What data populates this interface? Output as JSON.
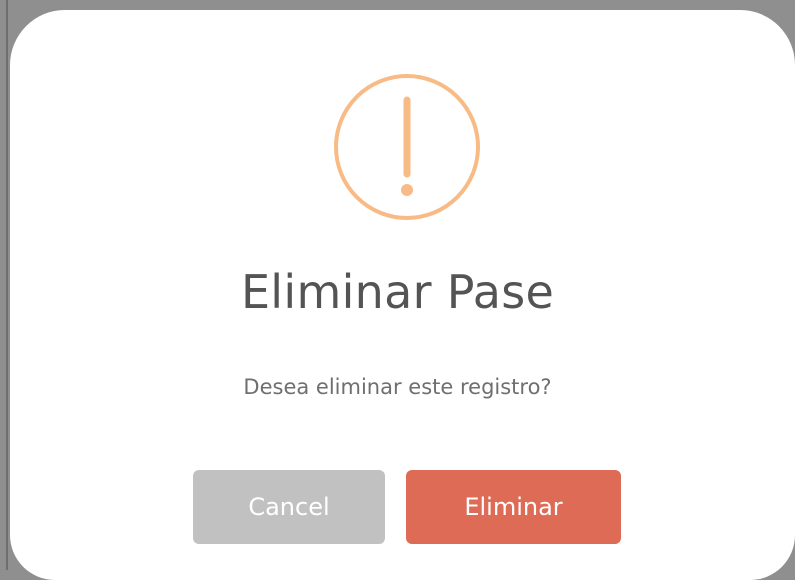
{
  "dialog": {
    "icon": "warning-exclamation-icon",
    "title": "Eliminar Pase",
    "message": "Desea eliminar este registro?",
    "cancel_label": "Cancel",
    "confirm_label": "Eliminar"
  },
  "colors": {
    "warning_icon": "#f8bb86",
    "title_text": "#545454",
    "message_text": "#6f6f6f",
    "cancel_button": "#c1c1c1",
    "confirm_button": "#dd6b55",
    "overlay": "#8f8f8f"
  }
}
